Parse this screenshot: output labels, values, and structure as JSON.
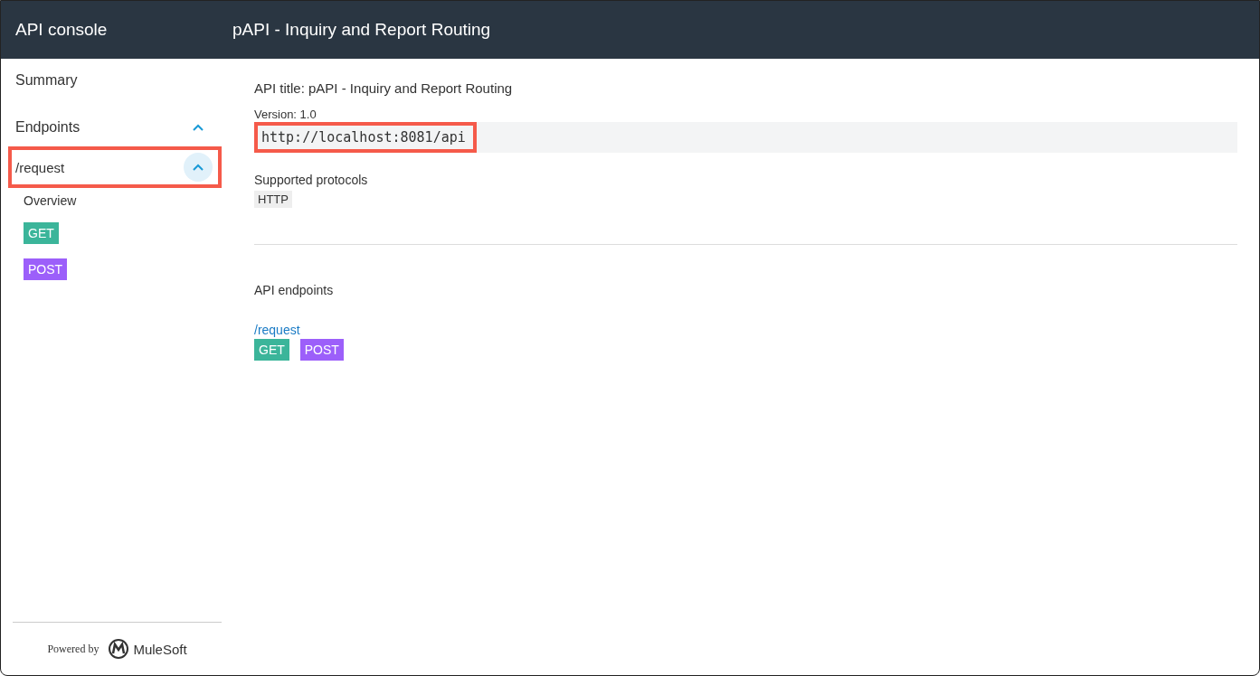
{
  "header": {
    "app_title": "API console",
    "page_title": "pAPI - Inquiry and Report Routing"
  },
  "sidebar": {
    "summary": "Summary",
    "endpoints_label": "Endpoints",
    "endpoints_expanded": true,
    "endpoints": [
      {
        "path": "/request",
        "expanded": true,
        "highlighted": true,
        "overview": "Overview",
        "methods": [
          {
            "label": "GET",
            "color": "#3bb59a"
          },
          {
            "label": "POST",
            "color": "#9c5ffa"
          }
        ]
      }
    ],
    "footer": {
      "powered_by": "Powered by",
      "brand": "MuleSoft"
    }
  },
  "main": {
    "api_title": "API title: pAPI - Inquiry and Report Routing",
    "version": "Version: 1.0",
    "base_url": "http://localhost:8081/api",
    "base_url_highlighted": true,
    "protocols_label": "Supported protocols",
    "protocols": [
      "HTTP"
    ],
    "endpoints_heading": "API endpoints",
    "endpoints": [
      {
        "path": "/request",
        "methods": [
          {
            "label": "GET",
            "color": "#3bb59a"
          },
          {
            "label": "POST",
            "color": "#9c5ffa"
          }
        ]
      }
    ]
  }
}
